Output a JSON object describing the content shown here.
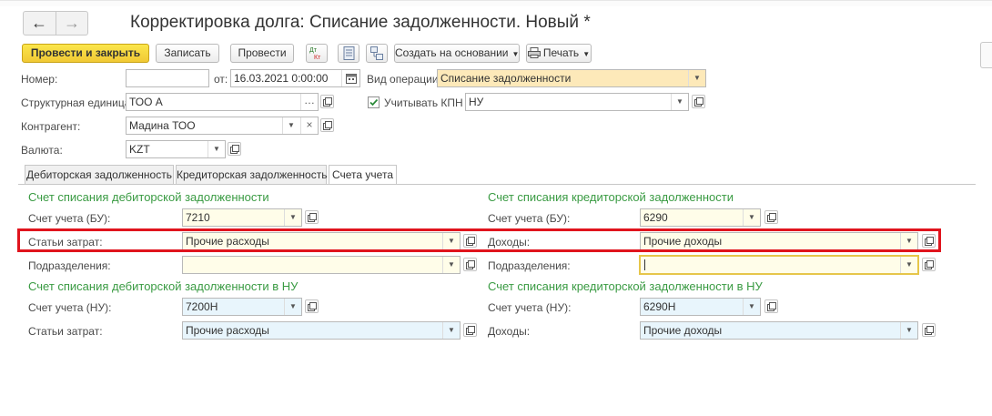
{
  "window": {
    "title": "Корректировка долга: Списание задолженности. Новый *"
  },
  "toolbar": {
    "post_close": "Провести и закрыть",
    "save": "Записать",
    "post": "Провести",
    "dtkt_top": "Дт",
    "dtkt_bottom": "Кт",
    "create_based": "Создать на основании",
    "print": "Печать"
  },
  "header": {
    "number_label": "Номер:",
    "number_value": "",
    "date_label": "от:",
    "date_value": "16.03.2021  0:00:00",
    "operation_label": "Вид операции:",
    "operation_value": "Списание задолженности",
    "unit_label": "Структурная единица:",
    "unit_value": "ТОО А",
    "kpn_label": "Учитывать КПН",
    "kpn_checked": true,
    "kpn_value": "НУ",
    "counterparty_label": "Контрагент:",
    "counterparty_value": "Мадина ТОО",
    "currency_label": "Валюта:",
    "currency_value": "KZT"
  },
  "tabs": [
    {
      "label": "Дебиторская задолженность",
      "active": false
    },
    {
      "label": "Кредиторская задолженность",
      "active": false
    },
    {
      "label": "Счета учета",
      "active": true
    }
  ],
  "debit_bu": {
    "title": "Счет списания дебиторской задолженности",
    "account_label": "Счет учета (БУ):",
    "account_value": "7210",
    "cost_label": "Статьи затрат:",
    "cost_value": "Прочие расходы",
    "division_label": "Подразделения:",
    "division_value": ""
  },
  "credit_bu": {
    "title": "Счет списания кредиторской задолженности",
    "account_label": "Счет учета (БУ):",
    "account_value": "6290",
    "income_label": "Доходы:",
    "income_value": "Прочие доходы",
    "division_label": "Подразделения:",
    "division_value": ""
  },
  "debit_nu": {
    "title": "Счет списания дебиторской задолженности в НУ",
    "account_label": "Счет учета (НУ):",
    "account_value": "7200Н",
    "cost_label": "Статьи затрат:",
    "cost_value": "Прочие расходы"
  },
  "credit_nu": {
    "title": "Счет списания кредиторской задолженности в НУ",
    "account_label": "Счет учета (НУ):",
    "account_value": "6290Н",
    "income_label": "Доходы:",
    "income_value": "Прочие доходы"
  },
  "colors": {
    "highlight_border": "#e0141d",
    "section_title": "#3a9b43",
    "primary_button": "#f1c935"
  }
}
